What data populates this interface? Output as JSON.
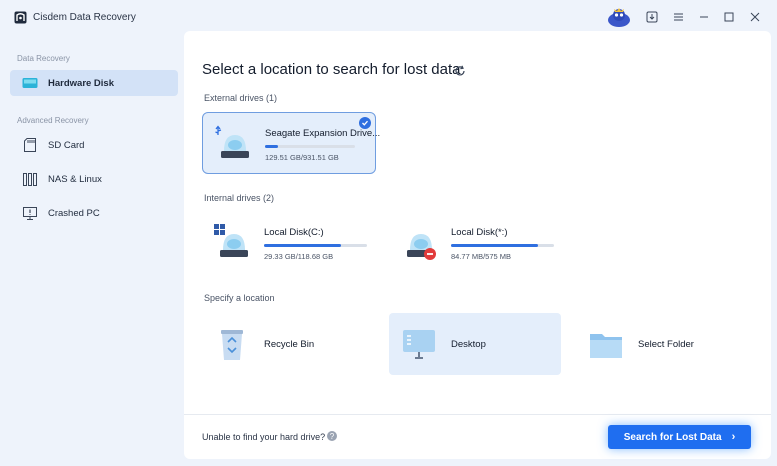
{
  "app": {
    "title": "Cisdem Data Recovery"
  },
  "titlebar": {
    "icons": [
      "account-avatar-icon",
      "download-icon",
      "menu-icon",
      "minimize-icon",
      "maximize-icon",
      "close-icon"
    ]
  },
  "sidebar": {
    "section1": "Data Recovery",
    "section2": "Advanced Recovery",
    "items": [
      {
        "label": "Hardware Disk",
        "icon": "hard-disk-icon",
        "active": true
      },
      {
        "label": "SD Card",
        "icon": "sd-card-icon"
      },
      {
        "label": "NAS & Linux",
        "icon": "nas-icon"
      },
      {
        "label": "Crashed PC",
        "icon": "crashed-pc-icon"
      }
    ]
  },
  "main": {
    "heading": "Select a location to search for lost data",
    "external_label": "External drives (1)",
    "internal_label": "Internal drives (2)",
    "location_label": "Specify a location",
    "external_drives": [
      {
        "name": "Seagate Expansion Drive...",
        "size": "129.51 GB/931.51 GB",
        "used_fraction": 0.14,
        "selected": true
      }
    ],
    "internal_drives": [
      {
        "name": "Local Disk(C:)",
        "size": "29.33 GB/118.68 GB",
        "used_fraction": 0.75
      },
      {
        "name": "Local Disk(*:)",
        "size": "84.77 MB/575 MB",
        "used_fraction": 0.84
      }
    ],
    "locations": [
      {
        "name": "Recycle Bin",
        "icon": "recycle-bin-icon"
      },
      {
        "name": "Desktop",
        "icon": "desktop-icon"
      },
      {
        "name": "Select Folder",
        "icon": "folder-icon"
      }
    ],
    "help_text": "Unable to find your hard drive?",
    "search_button": "Search for Lost Data"
  },
  "colors": {
    "accent": "#1f6ef0",
    "selected_bg": "#e4eefb",
    "sidebar_active": "#d3e2f7"
  }
}
